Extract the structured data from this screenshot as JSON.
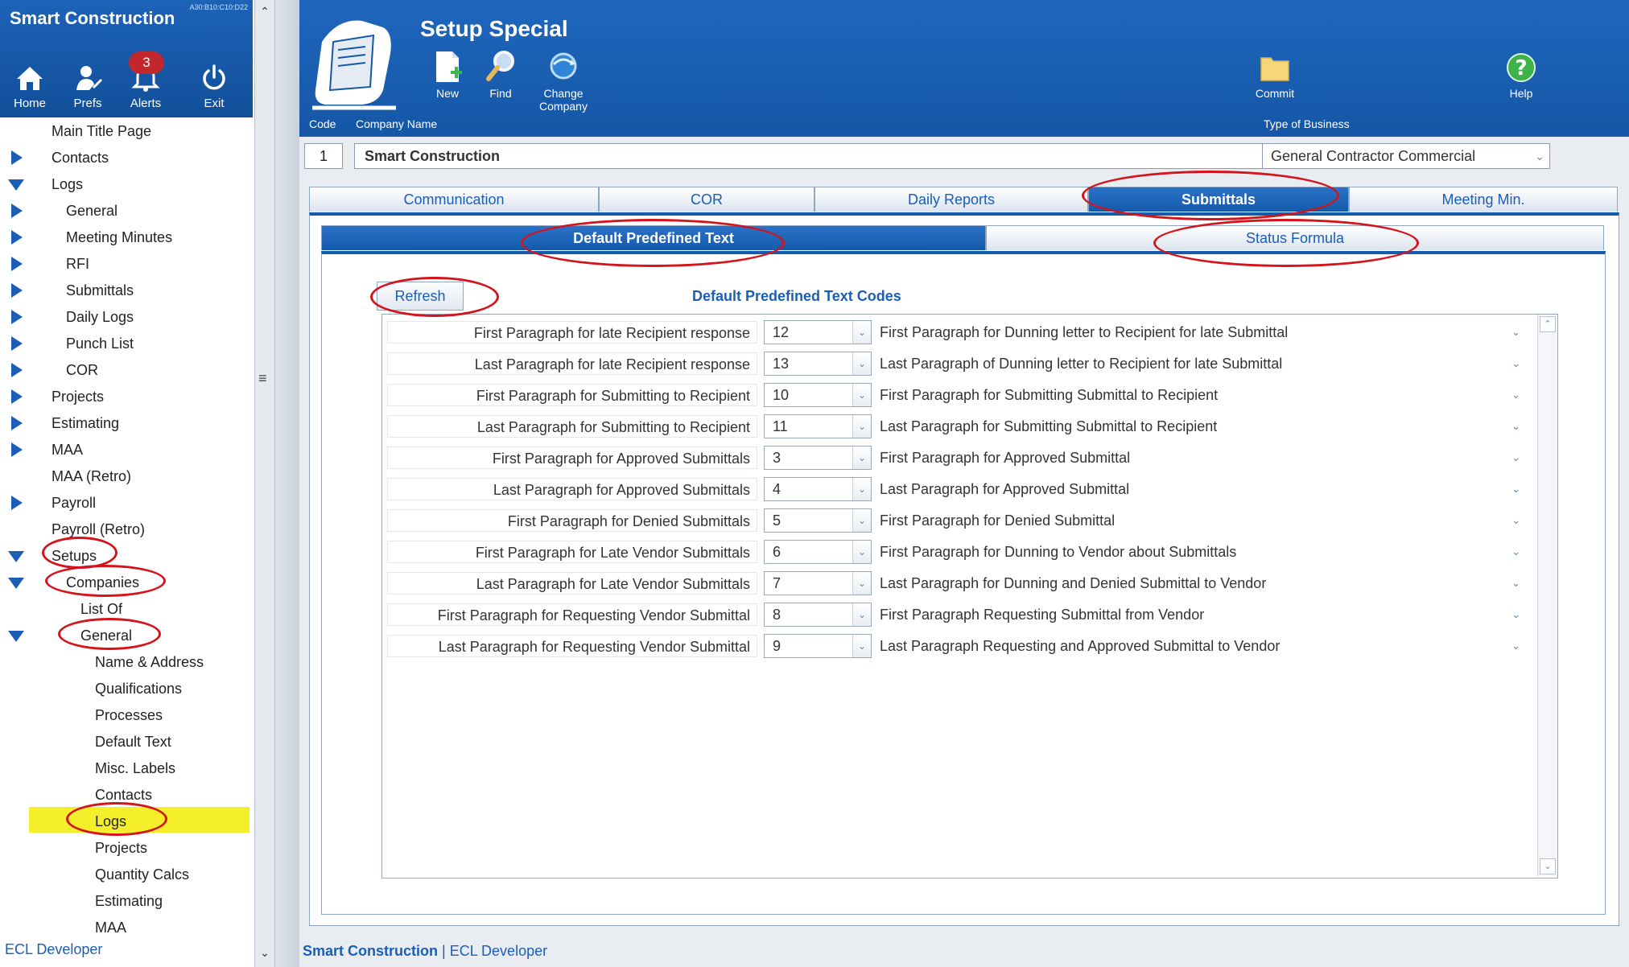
{
  "sidebar": {
    "app_title": "Smart Construction",
    "version": "A30:B10:C10:D22",
    "nav": {
      "home": "Home",
      "prefs": "Prefs",
      "alerts": "Alerts",
      "alerts_count": "3",
      "exit": "Exit"
    },
    "tree": [
      {
        "label": "Main Title Page"
      },
      {
        "label": "Contacts"
      },
      {
        "label": "Logs"
      },
      {
        "label": "General"
      },
      {
        "label": "Meeting Minutes"
      },
      {
        "label": "RFI"
      },
      {
        "label": "Submittals"
      },
      {
        "label": "Daily Logs"
      },
      {
        "label": "Punch List"
      },
      {
        "label": "COR"
      },
      {
        "label": "Projects"
      },
      {
        "label": "Estimating"
      },
      {
        "label": "MAA"
      },
      {
        "label": "MAA (Retro)"
      },
      {
        "label": "Payroll"
      },
      {
        "label": "Payroll (Retro)"
      },
      {
        "label": "Setups"
      },
      {
        "label": "Companies"
      },
      {
        "label": "List Of"
      },
      {
        "label": "General"
      },
      {
        "label": "Name & Address"
      },
      {
        "label": "Qualifications"
      },
      {
        "label": "Processes"
      },
      {
        "label": "Default Text"
      },
      {
        "label": "Misc. Labels"
      },
      {
        "label": "Contacts"
      },
      {
        "label": "Logs"
      },
      {
        "label": "Projects"
      },
      {
        "label": "Quantity Calcs"
      },
      {
        "label": "Estimating"
      },
      {
        "label": "MAA"
      }
    ],
    "footer": "ECL Developer",
    "highlight_color": "#f4ef2a"
  },
  "header": {
    "title": "Setup Special",
    "buttons": {
      "new": "New",
      "find": "Find",
      "change_company": "Change Company",
      "commit": "Commit",
      "help": "Help"
    },
    "labels": {
      "code": "Code",
      "company_name": "Company Name",
      "type_of_business": "Type of Business"
    }
  },
  "company": {
    "code": "1",
    "name": "Smart Construction",
    "business_type": "General Contractor Commercial"
  },
  "tabs": [
    "Communication",
    "COR",
    "Daily Reports",
    "Submittals",
    "Meeting Min."
  ],
  "active_tab": "Submittals",
  "subtabs": [
    "Default Predefined Text",
    "Status Formula"
  ],
  "active_subtab": "Default Predefined Text",
  "content": {
    "refresh": "Refresh",
    "section_title": "Default Predefined Text Codes",
    "rows": [
      {
        "label": "First Paragraph for late Recipient response",
        "code": "12",
        "text": "First Paragraph for Dunning letter to Recipient for late Submittal"
      },
      {
        "label": "Last Paragraph for late Recipient response",
        "code": "13",
        "text": "Last Paragraph of Dunning letter to Recipient for late Submittal"
      },
      {
        "label": "First Paragraph for Submitting to Recipient",
        "code": "10",
        "text": "First Paragraph for Submitting Submittal to Recipient"
      },
      {
        "label": "Last Paragraph for Submitting to Recipient",
        "code": "11",
        "text": "Last Paragraph for Submitting Submittal to Recipient"
      },
      {
        "label": "First Paragraph for Approved Submittals",
        "code": "3",
        "text": "First Paragraph for Approved Submittal"
      },
      {
        "label": "Last Paragraph for Approved Submittals",
        "code": "4",
        "text": "Last Paragraph for Approved Submittal"
      },
      {
        "label": "First Paragraph for Denied Submittals",
        "code": "5",
        "text": "First Paragraph for Denied Submittal"
      },
      {
        "label": "First Paragraph for Late Vendor Submittals",
        "code": "6",
        "text": "First Paragraph for Dunning to Vendor about Submittals"
      },
      {
        "label": "Last Paragraph for Late Vendor Submittals",
        "code": "7",
        "text": "Last Paragraph for Dunning and Denied Submittal to Vendor"
      },
      {
        "label": "First Paragraph for Requesting Vendor Submittal",
        "code": "8",
        "text": "First Paragraph Requesting Submittal from Vendor"
      },
      {
        "label": "Last Paragraph for Requesting Vendor Submittal",
        "code": "9",
        "text": "Last Paragraph Requesting and Approved Submittal to Vendor"
      }
    ]
  },
  "footer": {
    "app": "Smart Construction",
    "separator": " | ",
    "user": "ECL Developer"
  },
  "colors": {
    "brand_blue": "#1a5eb5",
    "header_blue": "#1557a6",
    "annotation_red": "#d4131b"
  }
}
